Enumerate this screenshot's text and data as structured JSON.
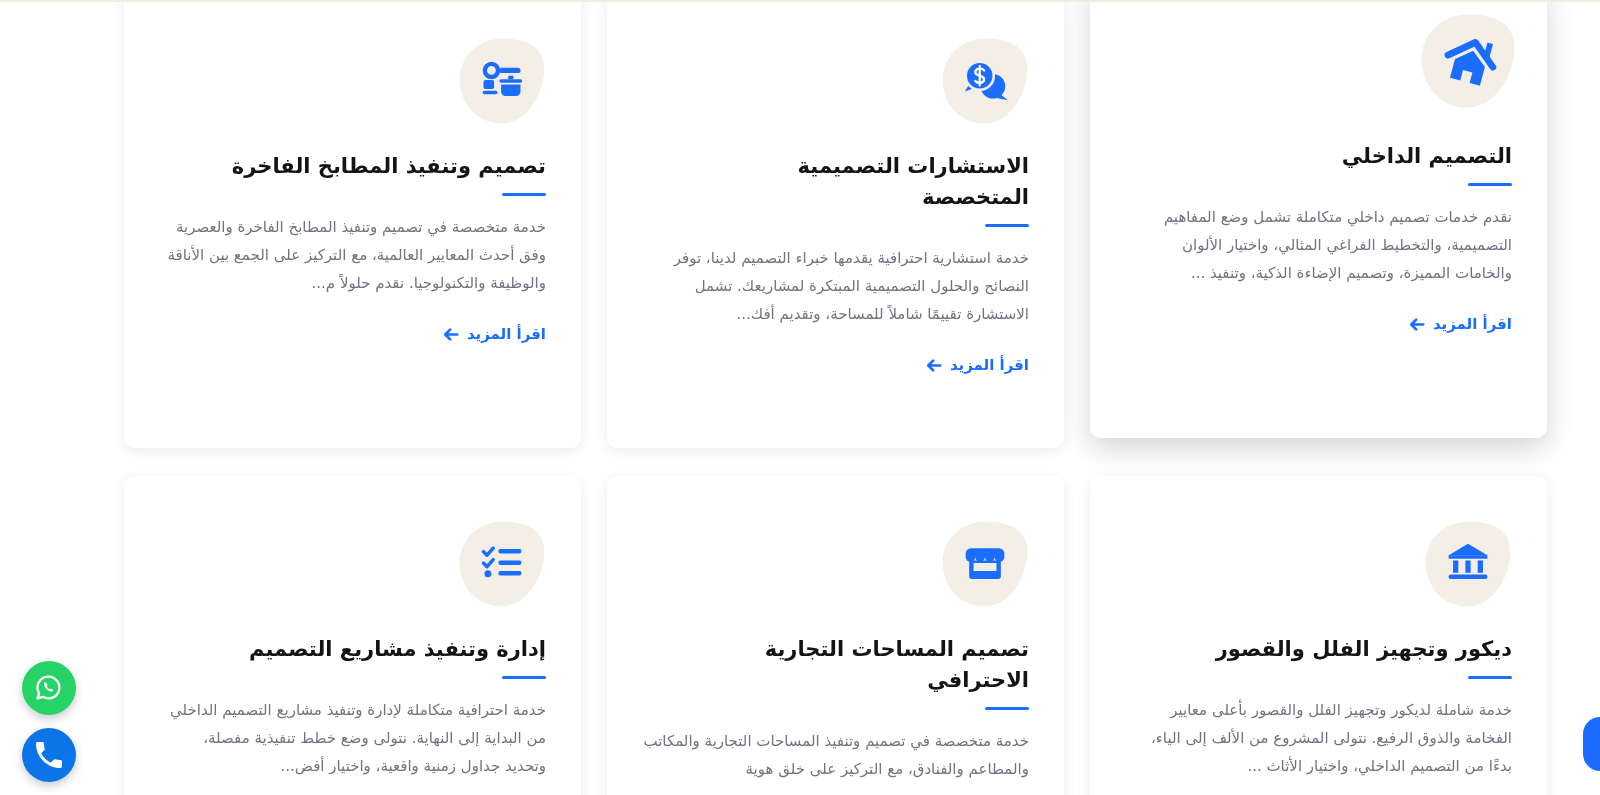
{
  "services": [
    {
      "title": "التصميم الداخلي",
      "description": "نقدم خدمات تصميم داخلي متكاملة تشمل وضع المفاهيم التصميمية، والتخطيط الفراغي المثالي، واختيار الألوان والخامات المميزة، وتصميم الإضاءة الذكية، وتنفيذ ...",
      "link_label": "اقرأ المزيد",
      "hovered": true
    },
    {
      "title": "الاستشارات التصميمية المتخصصة",
      "description": "خدمة استشارية احترافية يقدمها خبراء التصميم لدينا، توفر النصائح والحلول التصميمية المبتكرة لمشاريعك. تشمل الاستشارة تقييمًا شاملاً للمساحة، وتقديم أفك...",
      "link_label": "اقرأ المزيد",
      "hovered": false
    },
    {
      "title": "تصميم وتنفيذ المطابخ الفاخرة",
      "description": "خدمة متخصصة في تصميم وتنفيذ المطابخ الفاخرة والعصرية وفق أحدث المعايير العالمية، مع التركيز على الجمع بين الأناقة والوظيفة والتكنولوجيا. نقدم حلولاً م...",
      "link_label": "اقرأ المزيد",
      "hovered": false
    },
    {
      "title": "ديكور وتجهيز الفلل والقصور",
      "description": "خدمة شاملة لديكور وتجهيز الفلل والقصور بأعلى معايير الفخامة والذوق الرفيع. نتولى المشروع من الألف إلى الياء، بدءًا من التصميم الداخلي، واختيار الأثاث ...",
      "hovered": false
    },
    {
      "title": "تصميم المساحات التجارية الاحترافي",
      "description": "خدمة متخصصة في تصميم وتنفيذ المساحات التجارية والمكاتب والمطاعم والفنادق، مع التركيز على خلق هوية",
      "hovered": false
    },
    {
      "title": "إدارة وتنفيذ مشاريع التصميم",
      "description": "خدمة احترافية متكاملة لإدارة وتنفيذ مشاريع التصميم الداخلي من البداية إلى النهاية. نتولى وضع خطط تنفيذية مفصلة، وتحديد جداول زمنية واقعية، واختيار أفض...",
      "hovered": false
    }
  ]
}
